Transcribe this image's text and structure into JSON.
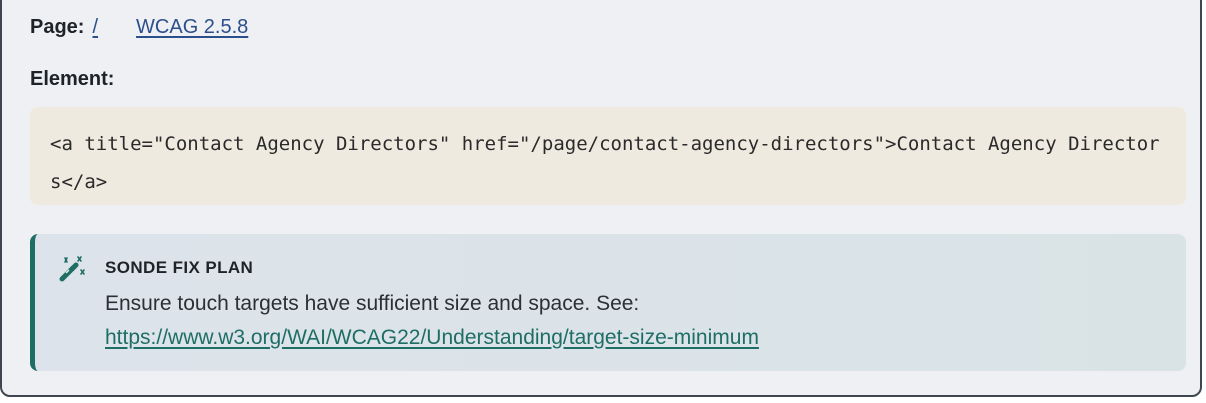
{
  "page": {
    "label": "Page:",
    "path_link": "/",
    "wcag_link": "WCAG 2.5.8"
  },
  "element": {
    "label": "Element:",
    "code": "<a title=\"Contact Agency Directors\" href=\"/page/contact-agency-directors\">Contact Agency Directors</a>"
  },
  "fix_plan": {
    "icon": "magic-wand-icon",
    "title": "SONDE FIX PLAN",
    "text": "Ensure touch targets have sufficient size and space. See:",
    "link": "https://www.w3.org/WAI/WCAG22/Understanding/target-size-minimum"
  },
  "colors": {
    "accent": "#1e6e66",
    "link": "#2b4f8a",
    "code_bg": "#efeadf",
    "card_bg": "#eef0f3"
  }
}
